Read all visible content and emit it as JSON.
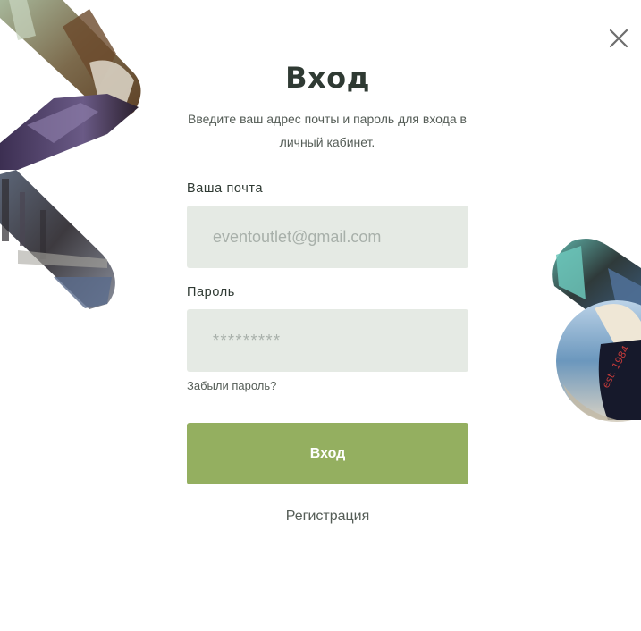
{
  "modal": {
    "title": "Вход",
    "subtitle": "Введите ваш адрес почты и пароль для входа в личный кабинет."
  },
  "form": {
    "email_label": "Ваша почта",
    "email_placeholder": "eventoutlet@gmail.com",
    "password_label": "Пароль",
    "password_placeholder": "*********",
    "forgot_link": "Забыли пароль?",
    "submit_label": "Вход",
    "register_link": "Регистрация"
  },
  "decor": {
    "photo_badge_text": "est. 1984"
  },
  "colors": {
    "accent": "#94af60",
    "input_bg": "#e5eae4",
    "title": "#2f3a33"
  },
  "icons": {
    "close": "close-icon"
  }
}
